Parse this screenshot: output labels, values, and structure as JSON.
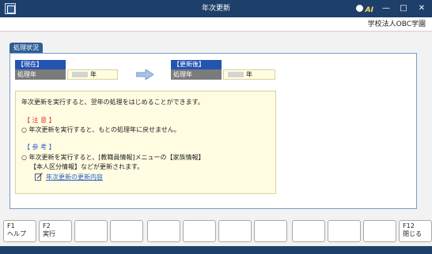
{
  "window": {
    "title": "年次更新",
    "ai_label": "AI",
    "minimize_glyph": "—",
    "maximize_glyph": "□",
    "close_glyph": "✕"
  },
  "org_name": "学校法人OBC学園",
  "section_tab": "処理状況",
  "current": {
    "header": "【現在】",
    "field_label": "処理年",
    "unit": "年"
  },
  "after": {
    "header": "【更新後】",
    "field_label": "処理年",
    "unit": "年"
  },
  "arrow_icon": "right-arrow-icon",
  "note": {
    "line1": "年次更新を実行すると、翌年の処理をはじめることができます。",
    "caution_heading": "【 注 意 】",
    "caution_text": "○ 年次更新を実行すると、もとの処理年に戻せません。",
    "reference_heading": "【 参 考 】",
    "reference_text1": "○ 年次更新を実行すると、[教職員情報]メニューの【家族情報】",
    "reference_text2": "【本人区分情報】などが更新されます。",
    "link": "年次更新の更新内容"
  },
  "fkeys": [
    {
      "key": "F1",
      "label": "ヘルプ"
    },
    {
      "key": "F2",
      "label": "実行"
    },
    {
      "key": "",
      "label": ""
    },
    {
      "key": "",
      "label": ""
    },
    {
      "key": "",
      "label": ""
    },
    {
      "key": "",
      "label": ""
    },
    {
      "key": "",
      "label": ""
    },
    {
      "key": "",
      "label": ""
    },
    {
      "key": "",
      "label": ""
    },
    {
      "key": "",
      "label": ""
    },
    {
      "key": "",
      "label": ""
    },
    {
      "key": "F12",
      "label": "閉じる"
    }
  ]
}
